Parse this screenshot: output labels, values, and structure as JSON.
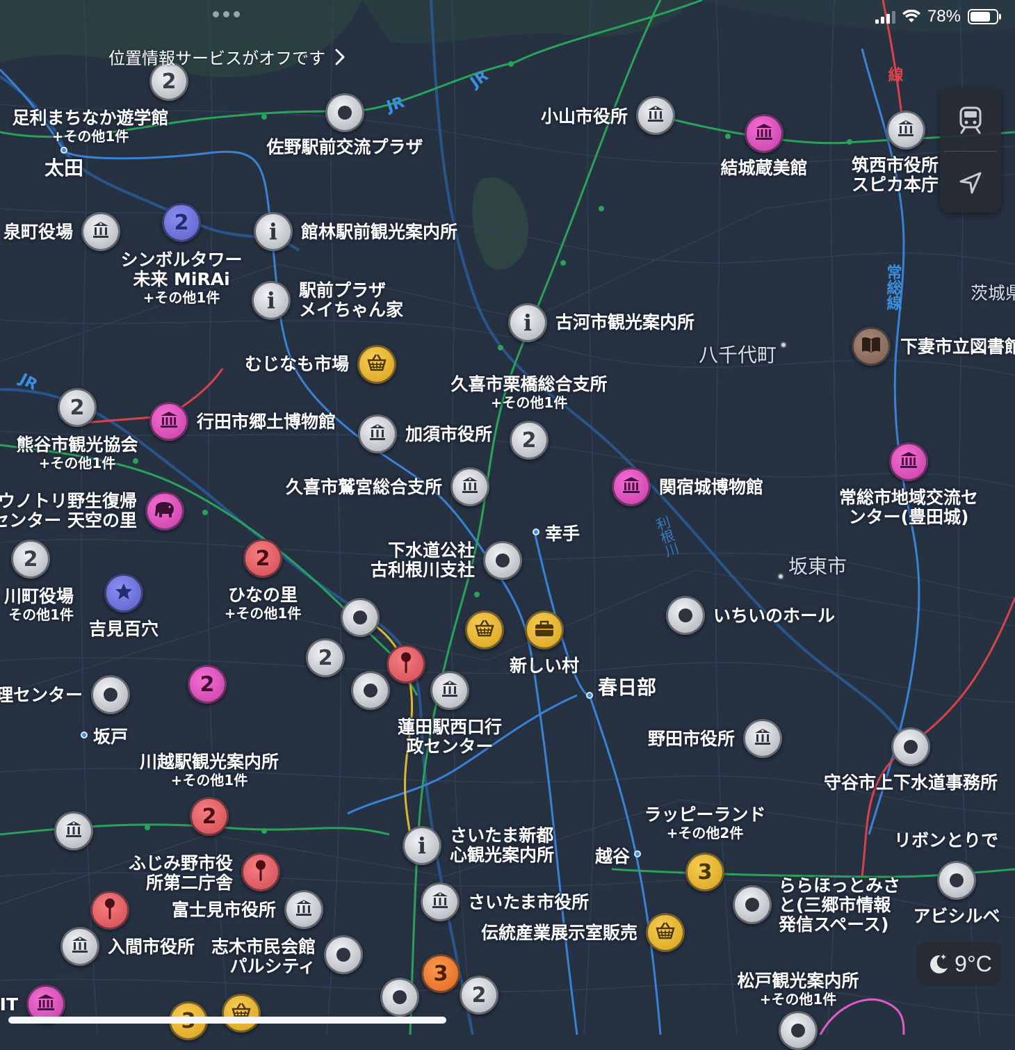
{
  "status_bar": {
    "battery_text": "78%",
    "battery_level": 0.78,
    "signal_bars": 3
  },
  "location_banner": {
    "text": "位置情報サービスがオフです",
    "chevron": "chevron-right-icon"
  },
  "controls": {
    "transit_icon": "train-icon",
    "locate_icon": "location-arrow-icon"
  },
  "weather": {
    "icon": "moon-stars-icon",
    "temperature": "9°C"
  },
  "map": {
    "road_labels": [
      "JR",
      "JR",
      "JR",
      "常総線",
      "線",
      "利根川"
    ],
    "places": [
      {
        "label": "太田"
      },
      {
        "label": "八千代町"
      },
      {
        "label": "坂東市"
      },
      {
        "label": "幸手"
      },
      {
        "label": "春日部"
      },
      {
        "label": "坂戸"
      },
      {
        "label": "越谷"
      },
      {
        "label": "茨城県"
      }
    ],
    "pois": [
      {
        "icon": "cluster",
        "color": "gray",
        "count": "2",
        "label": "足利まちなか遊学館",
        "sub": "+その他1件"
      },
      {
        "icon": "dot-icon",
        "color": "gray",
        "label": "佐野駅前交流プラザ"
      },
      {
        "icon": "government-icon",
        "color": "gray",
        "label": "小山市役所"
      },
      {
        "icon": "museum-icon",
        "color": "pink",
        "label": "結城蔵美館"
      },
      {
        "icon": "government-icon",
        "color": "gray",
        "label": "筑西市役所",
        "sub": "スピカ本庁"
      },
      {
        "icon": "government-icon",
        "color": "gray",
        "label": "泉町役場"
      },
      {
        "icon": "cluster",
        "color": "purple",
        "count": "2",
        "label": "シンボルタワー",
        "sub": "未来 MiRAi",
        "sub2": "+その他1件"
      },
      {
        "icon": "info-icon",
        "color": "gray",
        "label": "館林駅前観光案内所"
      },
      {
        "icon": "info-icon",
        "color": "gray",
        "label": "駅前プラザ",
        "sub": "メイちゃん家"
      },
      {
        "icon": "info-icon",
        "color": "gray",
        "label": "古河市観光案内所"
      },
      {
        "icon": "book-icon",
        "color": "brown",
        "label": "下妻市立図書館"
      },
      {
        "icon": "basket-icon",
        "color": "yellow",
        "label": "むじなも市場"
      },
      {
        "icon": "cluster",
        "color": "gray",
        "count": "2",
        "label": "熊谷市観光協会",
        "sub": "+その他1件"
      },
      {
        "icon": "museum-icon",
        "color": "pink",
        "label": "行田市郷土博物館"
      },
      {
        "icon": "government-icon",
        "color": "gray",
        "label": "加須市役所"
      },
      {
        "icon": "cluster",
        "color": "gray",
        "count": "2",
        "label": "久喜市栗橋総合支所",
        "sub": "+その他1件"
      },
      {
        "icon": "government-icon",
        "color": "gray",
        "label": "久喜市鷲宮総合支所"
      },
      {
        "icon": "museum-icon",
        "color": "pink",
        "label": "関宿城博物館"
      },
      {
        "icon": "museum-icon",
        "color": "pink",
        "label": "常総市地域交流セ",
        "sub": "ンター(豊田城)"
      },
      {
        "icon": "elephant-icon",
        "color": "pink",
        "label": "ウノトリ野生復帰",
        "sub": "センター 天空の里"
      },
      {
        "icon": "cluster",
        "color": "gray",
        "count": "2",
        "label": "川町役場",
        "sub": "その他1件"
      },
      {
        "icon": "star-icon",
        "color": "purple",
        "label": "吉見百穴"
      },
      {
        "icon": "cluster",
        "color": "red",
        "count": "2",
        "label": "ひなの里",
        "sub": "+その他1件"
      },
      {
        "icon": "dot-icon",
        "color": "gray",
        "label": "下水道公社",
        "sub": "古利根川支社"
      },
      {
        "icon": "dot-icon",
        "color": "gray",
        "label": "いちいのホール"
      },
      {
        "icon": "dot-icon",
        "color": "gray",
        "label": ""
      },
      {
        "icon": "basket-icon",
        "color": "yellow",
        "label": ""
      },
      {
        "icon": "bag-icon",
        "color": "yellow",
        "label": "新しい村"
      },
      {
        "icon": "cluster",
        "color": "gray",
        "count": "2",
        "label": ""
      },
      {
        "icon": "pin-icon",
        "color": "red",
        "label": ""
      },
      {
        "icon": "dot-icon",
        "color": "gray",
        "label": ""
      },
      {
        "icon": "government-icon",
        "color": "gray",
        "label": "蓮田駅西口行",
        "sub": "政センター"
      },
      {
        "icon": "dot-icon",
        "color": "gray",
        "label": "理センター"
      },
      {
        "icon": "cluster",
        "color": "pink",
        "count": "2",
        "label": ""
      },
      {
        "icon": "government-icon",
        "color": "gray",
        "label": "野田市役所"
      },
      {
        "icon": "dot-icon",
        "color": "gray",
        "label": "守谷市上下水道事務所"
      },
      {
        "icon": "cluster",
        "color": "red",
        "count": "2",
        "label": "川越駅観光案内所",
        "sub": "+その他1件"
      },
      {
        "icon": "government-icon",
        "color": "gray",
        "label": ""
      },
      {
        "icon": "pin-icon",
        "color": "red",
        "label": "ふじみ野市役",
        "sub": "所第二庁舎"
      },
      {
        "icon": "info-icon",
        "color": "gray",
        "label": "さいたま新都",
        "sub": "心観光案内所"
      },
      {
        "icon": "cluster",
        "color": "yellow",
        "count": "3",
        "label": "ラッピーランド",
        "sub": "+その他2件"
      },
      {
        "icon": "dot-icon",
        "color": "gray",
        "label": "ららほっとみさ",
        "sub": "と(三郷市情報",
        "sub2": "発信スペース)"
      },
      {
        "icon": "dot-icon",
        "color": "gray",
        "label": "アビシルベ"
      },
      {
        "icon": "pin-icon",
        "color": "red",
        "label": ""
      },
      {
        "icon": "government-icon",
        "color": "gray",
        "label": "富士見市役所"
      },
      {
        "icon": "government-icon",
        "color": "gray",
        "label": "さいたま市役所"
      },
      {
        "icon": "basket-icon",
        "color": "yellow",
        "label": "伝統産業展示室販売"
      },
      {
        "icon": "government-icon",
        "color": "gray",
        "label": "入間市役所"
      },
      {
        "icon": "dot-icon",
        "color": "gray",
        "label": "志木市民会館",
        "sub": "パルシティ"
      },
      {
        "icon": "cluster",
        "color": "orange",
        "count": "3",
        "label": ""
      },
      {
        "icon": "dot-icon",
        "color": "gray",
        "label": ""
      },
      {
        "icon": "cluster",
        "color": "gray",
        "count": "2",
        "label": ""
      },
      {
        "icon": "museum-icon",
        "color": "pink",
        "label": "IT"
      },
      {
        "icon": "cluster",
        "color": "yellow",
        "count": "3",
        "label": ""
      },
      {
        "icon": "basket-icon",
        "color": "yellow",
        "label": ""
      },
      {
        "icon": "dot-icon",
        "color": "gray",
        "label": "松戸観光案内所",
        "sub": "+その他1件"
      },
      {
        "icon": "text",
        "color": "",
        "label": "リボンとりで"
      }
    ]
  }
}
